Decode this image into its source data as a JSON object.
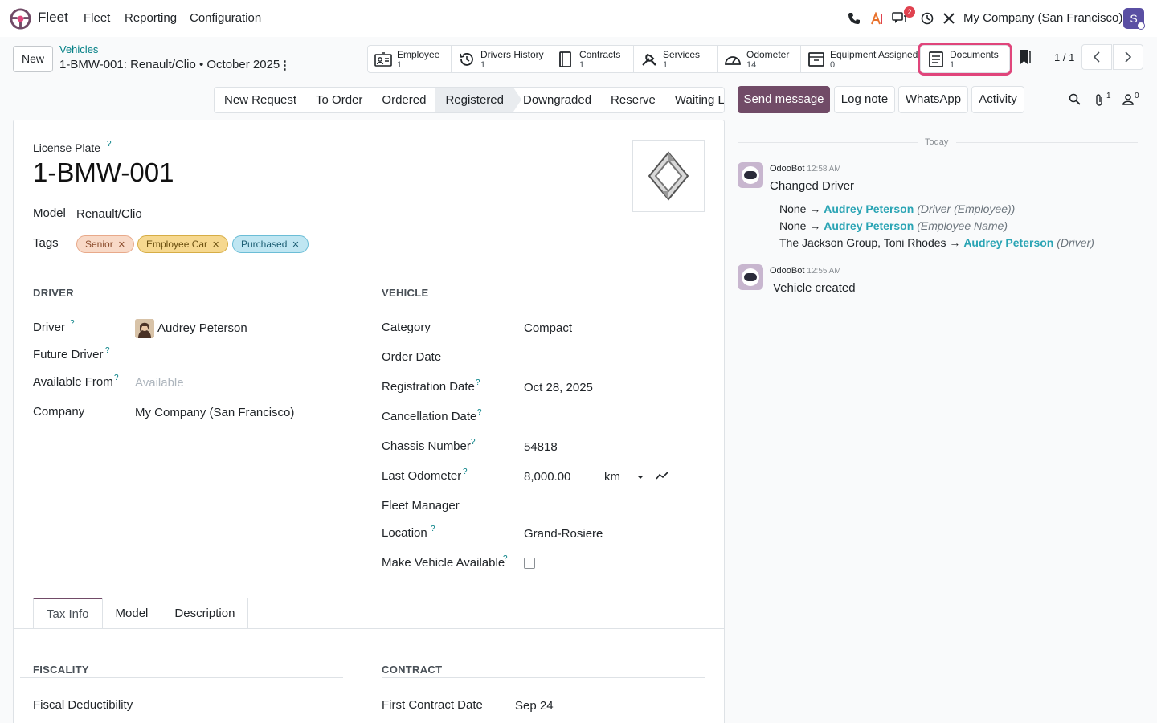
{
  "navbar": {
    "app_name": "Fleet",
    "menu": [
      "Fleet",
      "Reporting",
      "Configuration"
    ],
    "messages_badge": "2",
    "company": "My Company (San Francisco)",
    "user_initial": "S"
  },
  "breadcrumb": {
    "new_label": "New",
    "parent": "Vehicles",
    "current": "1-BMW-001: Renault/Clio • October 2025"
  },
  "smart_buttons": [
    {
      "label": "Employee",
      "count": "1",
      "icon": "id-card-icon"
    },
    {
      "label": "Drivers History",
      "count": "1",
      "icon": "history-icon"
    },
    {
      "label": "Contracts",
      "count": "1",
      "icon": "book-icon"
    },
    {
      "label": "Services",
      "count": "1",
      "icon": "wrench-icon"
    },
    {
      "label": "Odometer",
      "count": "14",
      "icon": "gauge-icon"
    },
    {
      "label": "Equipment Assigned",
      "count": "0",
      "icon": "drawer-icon"
    },
    {
      "label": "Documents",
      "count": "1",
      "icon": "document-icon"
    }
  ],
  "pager": {
    "value": "1 / 1"
  },
  "status_stages": [
    "New Request",
    "To Order",
    "Ordered",
    "Registered",
    "Downgraded",
    "Reserve",
    "Waiting List"
  ],
  "active_stage": "Registered",
  "chatter_buttons": {
    "send": "Send message",
    "log": "Log note",
    "whatsapp": "WhatsApp",
    "activity": "Activity",
    "attachments_count": "1",
    "followers_count": "0"
  },
  "form": {
    "license_plate_label": "License Plate",
    "license_plate": "1-BMW-001",
    "model_label": "Model",
    "model": "Renault/Clio",
    "tags_label": "Tags",
    "tags": [
      {
        "label": "Senior",
        "color": "#f8d9c7"
      },
      {
        "label": "Employee Car",
        "color": "#f6d88f"
      },
      {
        "label": "Purchased",
        "color": "#bfe6f2"
      }
    ],
    "driver_section": "DRIVER",
    "driver_label": "Driver",
    "driver": "Audrey Peterson",
    "future_driver_label": "Future Driver",
    "available_from_label": "Available From",
    "available_from_placeholder": "Available",
    "company_label": "Company",
    "company": "My Company (San Francisco)",
    "vehicle_section": "VEHICLE",
    "category_label": "Category",
    "category": "Compact",
    "order_date_label": "Order Date",
    "registration_date_label": "Registration Date",
    "registration_date": "Oct 28, 2025",
    "cancellation_date_label": "Cancellation Date",
    "chassis_label": "Chassis Number",
    "chassis": "54818",
    "odometer_label": "Last Odometer",
    "odometer": "8,000.00",
    "odometer_unit": "km",
    "fleet_manager_label": "Fleet Manager",
    "location_label": "Location",
    "location": "Grand-Rosiere",
    "make_available_label": "Make Vehicle Available",
    "tabs": [
      "Tax Info",
      "Model",
      "Description"
    ],
    "fiscality_section": "FISCALITY",
    "fiscal_label": "Fiscal Deductibility",
    "contract_section": "CONTRACT",
    "first_contract_label": "First Contract Date",
    "first_contract": "Sep 24"
  },
  "chatter": {
    "separator": "Today",
    "messages": [
      {
        "author": "OdooBot",
        "time": "12:58 AM",
        "body": "Changed Driver",
        "tracking": [
          {
            "old": "None",
            "new": "Audrey Peterson",
            "field": "(Driver (Employee))"
          },
          {
            "old": "None",
            "new": "Audrey Peterson",
            "field": "(Employee Name)"
          },
          {
            "old": "The Jackson Group, Toni Rhodes",
            "new": "Audrey Peterson",
            "field": "(Driver)"
          }
        ]
      },
      {
        "author": "OdooBot",
        "time": "12:55 AM",
        "body": "Vehicle created"
      }
    ]
  },
  "colors": {
    "primary": "#714b67",
    "link": "#017e84",
    "tracking_new": "#2aa4b4",
    "highlight": "#e0457b"
  }
}
